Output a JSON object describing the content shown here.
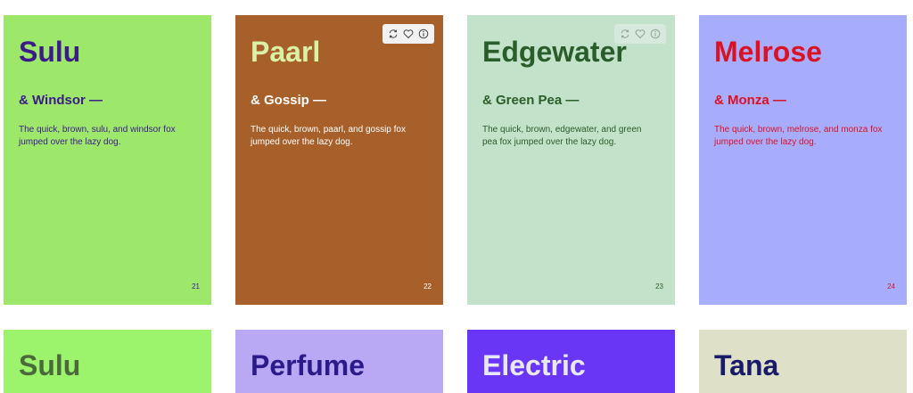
{
  "cards": [
    {
      "title": "Sulu",
      "subtitle": "& Windsor —",
      "body": "The quick, brown, sulu, and windsor fox jumped over the lazy dog.",
      "number": "21",
      "background": "#9de86a",
      "text_color": "#3b1a8a"
    },
    {
      "title": "Paarl",
      "subtitle": "& Gossip —",
      "body": "The quick, brown, paarl, and gossip fox jumped over the lazy dog.",
      "number": "22",
      "background": "#a8602b",
      "text_color": "#ffffff",
      "title_color": "#d9f2a6",
      "actions": [
        "refresh-icon",
        "heart-icon",
        "info-icon"
      ]
    },
    {
      "title": "Edgewater",
      "subtitle": "& Green Pea —",
      "body": "The quick, brown, edgewater, and green pea fox jumped over the lazy dog.",
      "number": "23",
      "background": "#c2e2ca",
      "text_color": "#2a5d2a",
      "actions": [
        "refresh-icon",
        "heart-icon",
        "info-icon"
      ]
    },
    {
      "title": "Melrose",
      "subtitle": "& Monza —",
      "body": "The quick, brown, melrose, and monza fox jumped over the lazy dog.",
      "number": "24",
      "background": "#a8acfc",
      "text_color": "#d91224"
    }
  ],
  "next_row": [
    {
      "title": "Sulu",
      "background": "#9cf46c",
      "text_color": "#4a6a3a"
    },
    {
      "title": "Perfume",
      "background": "#b9a8f3",
      "text_color": "#2a1a8a"
    },
    {
      "title": "Electric",
      "background": "#6a36f6",
      "text_color": "#e8e8f8"
    },
    {
      "title": "Tana",
      "background": "#dee0c8",
      "text_color": "#1a1a6a"
    }
  ]
}
